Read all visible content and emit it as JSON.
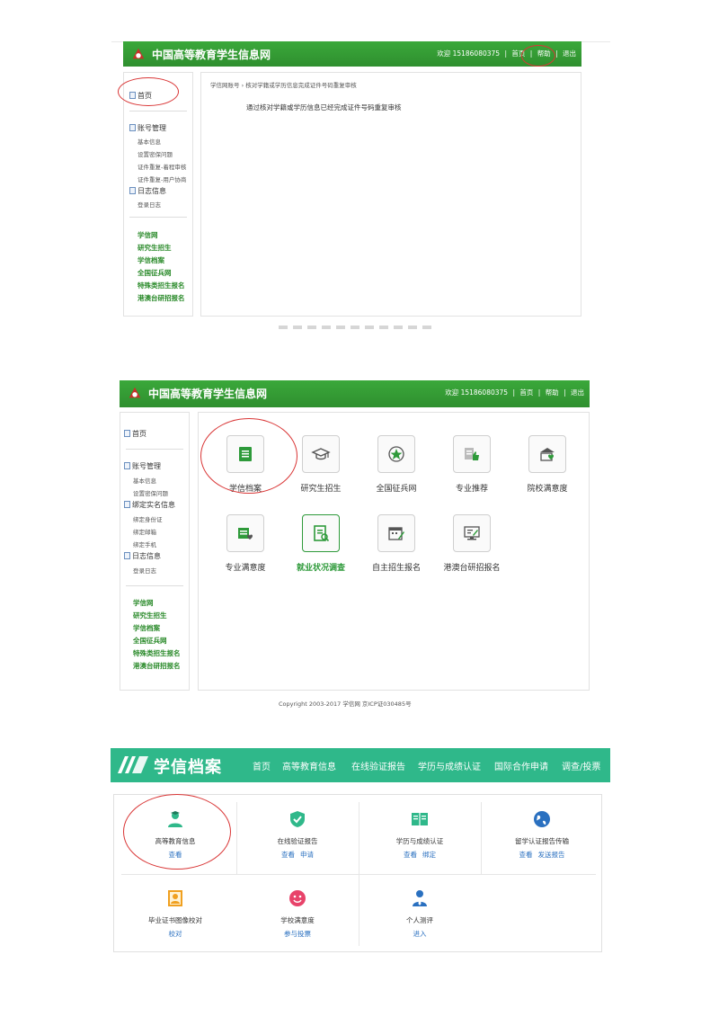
{
  "panel1": {
    "title": "中国高等教育学生信息网",
    "welcome": "欢迎 15186080375",
    "nav": [
      "首页",
      "帮助",
      "退出"
    ],
    "sidebar": {
      "home": "首页",
      "account": "账号管理",
      "account_items": [
        "基本信息",
        "设置密保问题",
        "证件重复-着程审核",
        "证件重复-用户协商"
      ],
      "log": "日志信息",
      "log_items": [
        "登录日志"
      ],
      "links": [
        "学信网",
        "研究生招生",
        "学信档案",
        "全国征兵网",
        "特殊类招生报名",
        "港澳台研招报名"
      ]
    },
    "breadcrumb": "学信网账号 › 核对学籍或学历信息完成证件号码重复审核",
    "message": "通过核对学籍或学历信息已经完成证件号码重复审核"
  },
  "panel2": {
    "title": "中国高等教育学生信息网",
    "welcome": "欢迎 15186080375",
    "nav": [
      "首页",
      "帮助",
      "退出"
    ],
    "sidebar": {
      "home": "首页",
      "account": "账号管理",
      "account_items": [
        "基本信息",
        "设置密保问题"
      ],
      "realname": "绑定实名信息",
      "realname_items": [
        "绑定身份证",
        "绑定邮箱",
        "绑定手机"
      ],
      "log": "日志信息",
      "log_items": [
        "登录日志"
      ],
      "links": [
        "学信网",
        "研究生招生",
        "学信档案",
        "全国征兵网",
        "特殊类招生报名",
        "港澳台研招报名"
      ]
    },
    "tiles": [
      {
        "label": "学信档案",
        "icon": "archive-icon"
      },
      {
        "label": "研究生招生",
        "icon": "graduation-cap-icon"
      },
      {
        "label": "全国征兵网",
        "icon": "star-badge-icon"
      },
      {
        "label": "专业推荐",
        "icon": "thumbs-up-icon"
      },
      {
        "label": "院校满意度",
        "icon": "school-heart-icon"
      },
      {
        "label": "专业满意度",
        "icon": "chart-heart-icon"
      },
      {
        "label": "就业状况调查",
        "icon": "survey-icon"
      },
      {
        "label": "自主招生报名",
        "icon": "calendar-edit-icon"
      },
      {
        "label": "港澳台研招报名",
        "icon": "monitor-edit-icon"
      }
    ],
    "footer": "Copyright 2003-2017    学信网    京ICP证030485号"
  },
  "panel3": {
    "title": "学信档案",
    "nav": [
      "首页",
      "高等教育信息",
      "在线验证报告",
      "学历与成绩认证",
      "国际合作申请",
      "调查/投票"
    ],
    "cards": [
      {
        "title": "高等教育信息",
        "links": [
          "查看"
        ],
        "icon": "student-icon",
        "color": "#2fb88a"
      },
      {
        "title": "在线验证报告",
        "links": [
          "查看",
          "申请"
        ],
        "icon": "shield-check-icon",
        "color": "#2fb88a"
      },
      {
        "title": "学历与成绩认证",
        "links": [
          "查看",
          "绑定"
        ],
        "icon": "book-icon",
        "color": "#2fb88a"
      },
      {
        "title": "留学认证报告传输",
        "links": [
          "查看",
          "发送报告"
        ],
        "icon": "globe-icon",
        "color": "#2a70c0"
      },
      {
        "title": "毕业证书图像校对",
        "links": [
          "校对"
        ],
        "icon": "id-photo-icon",
        "color": "#f0a020"
      },
      {
        "title": "学校满意度",
        "links": [
          "参与投票"
        ],
        "icon": "smiley-icon",
        "color": "#e8436a"
      },
      {
        "title": "个人测评",
        "links": [
          "进入"
        ],
        "icon": "person-tie-icon",
        "color": "#2a70c0"
      }
    ]
  }
}
